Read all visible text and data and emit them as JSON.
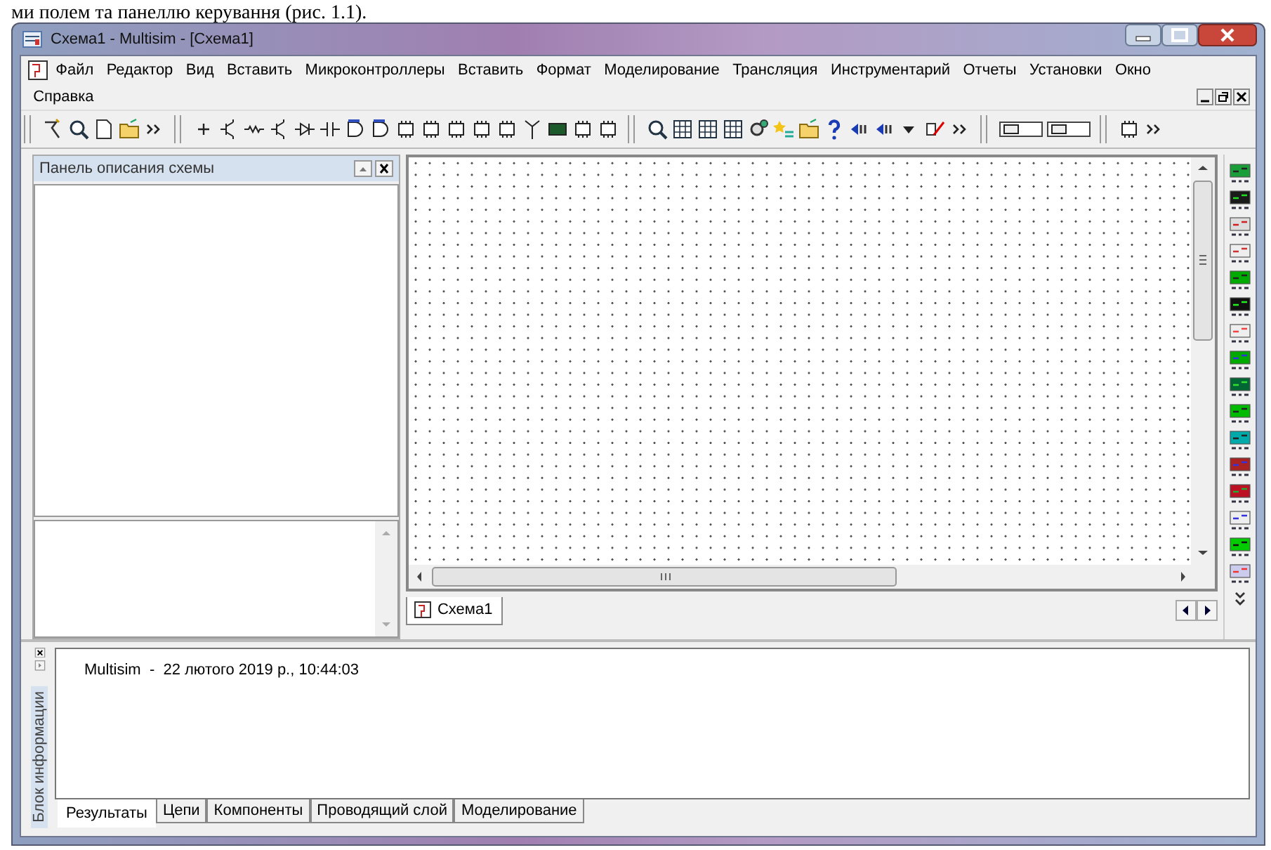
{
  "document_text": "ми полем та панеллю керування (рис. 1.1).",
  "window": {
    "title": "Схема1 - Multisim - [Схема1]"
  },
  "menu": [
    {
      "label": "Файл"
    },
    {
      "label": "Редактор"
    },
    {
      "label": "Вид"
    },
    {
      "label": "Вставить"
    },
    {
      "label": "Микроконтроллеры"
    },
    {
      "label": "Вставить"
    },
    {
      "label": "Формат"
    },
    {
      "label": "Моделирование"
    },
    {
      "label": "Трансляция"
    },
    {
      "label": "Инструментарий"
    },
    {
      "label": "Отчеты"
    },
    {
      "label": "Установки"
    },
    {
      "label": "Окно"
    },
    {
      "label": "Справка"
    }
  ],
  "description_panel": {
    "title": "Панель описания схемы"
  },
  "canvas_tabs": [
    {
      "label": "Схема1",
      "selected": true
    }
  ],
  "info_panel": {
    "side_label": "Блок информации",
    "log": "Multisim  -  22 лютого 2019 р., 10:44:03",
    "tabs": [
      {
        "label": "Результаты",
        "selected": true
      },
      {
        "label": "Цепи",
        "selected": false
      },
      {
        "label": "Компоненты",
        "selected": false
      },
      {
        "label": "Проводящий слой",
        "selected": false
      },
      {
        "label": "Моделирование",
        "selected": false
      }
    ]
  }
}
